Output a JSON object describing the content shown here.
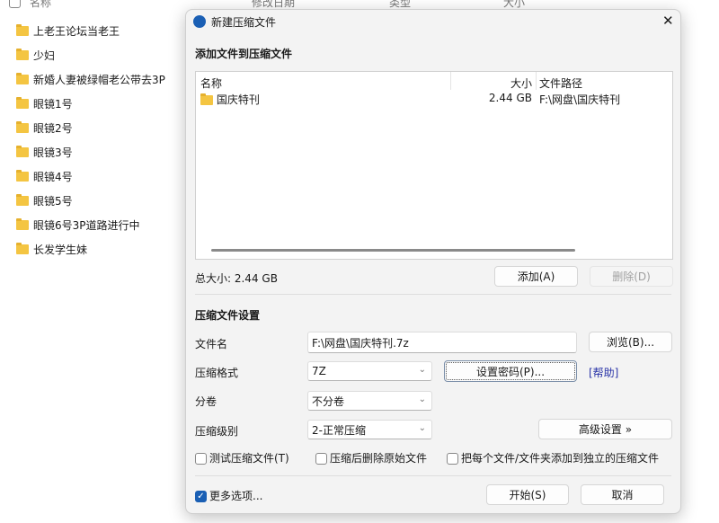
{
  "explorer": {
    "columns": [
      "名称",
      "修改日期",
      "类型",
      "大小"
    ],
    "items": [
      "上老王论坛当老王",
      "少妇",
      "新婚人妻被绿帽老公带去3P",
      "眼镜1号",
      "眼镜2号",
      "眼镜3号",
      "眼镜4号",
      "眼镜5号",
      "眼镜6号3P道路进行中",
      "长发学生妹"
    ]
  },
  "dialog": {
    "title": "新建压缩文件",
    "close": "✕",
    "add_section": "添加文件到压缩文件",
    "list": {
      "headers": {
        "name": "名称",
        "size": "大小",
        "path": "文件路径"
      },
      "rows": [
        {
          "name": "国庆特刊",
          "size": "2.44 GB",
          "path": "F:\\网盘\\国庆特刊"
        }
      ]
    },
    "total": "总大小: 2.44 GB",
    "add_btn": "添加(A)",
    "delete_btn": "删除(D)",
    "settings_section": "压缩文件设置",
    "filename_label": "文件名",
    "filename_value": "F:\\网盘\\国庆特刊.7z",
    "browse_btn": "浏览(B)...",
    "format_label": "压缩格式",
    "format_value": "7Z",
    "password_btn": "设置密码(P)...",
    "help_link": "[帮助]",
    "split_label": "分卷",
    "split_value": "不分卷",
    "level_label": "压缩级别",
    "level_value": "2-正常压缩",
    "advanced_btn": "高级设置 »",
    "opt_test": "测试压缩文件(T)",
    "opt_delete": "压缩后删除原始文件",
    "opt_separate": "把每个文件/文件夹添加到独立的压缩文件",
    "more_options": "更多选项...",
    "more_options_checked": true,
    "start_btn": "开始(S)",
    "cancel_btn": "取消"
  },
  "colors": {
    "accent": "#1a5fb4",
    "link": "#2b35a8"
  }
}
